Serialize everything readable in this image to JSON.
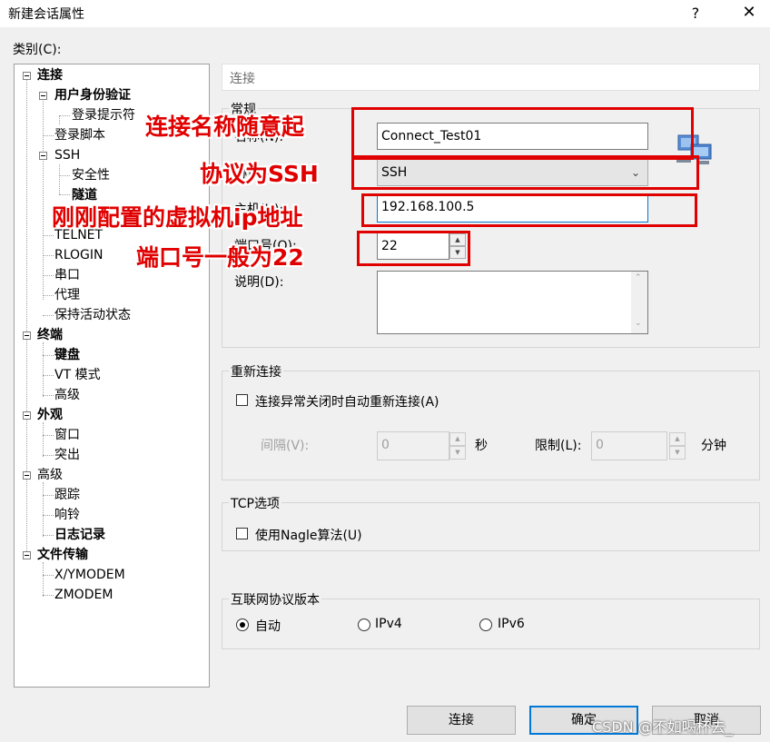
{
  "window": {
    "title": "新建会话属性",
    "help_label": "?",
    "close_label": "✕"
  },
  "category_label": "类别(C):",
  "tree": {
    "items": [
      {
        "label": "连接"
      },
      {
        "label": "用户身份验证"
      },
      {
        "label": "登录提示符"
      },
      {
        "label": "登录脚本"
      },
      {
        "label": "SSH"
      },
      {
        "label": "安全性"
      },
      {
        "label": "隧道"
      },
      {
        "label": "TELNET"
      },
      {
        "label": "RLOGIN"
      },
      {
        "label": "串口"
      },
      {
        "label": "代理"
      },
      {
        "label": "保持活动状态"
      },
      {
        "label": "终端"
      },
      {
        "label": "键盘"
      },
      {
        "label": "VT 模式"
      },
      {
        "label": "高级"
      },
      {
        "label": "外观"
      },
      {
        "label": "窗口"
      },
      {
        "label": "突出"
      },
      {
        "label": "高级"
      },
      {
        "label": "跟踪"
      },
      {
        "label": "响铃"
      },
      {
        "label": "日志记录"
      },
      {
        "label": "文件传输"
      },
      {
        "label": "X/YMODEM"
      },
      {
        "label": "ZMODEM"
      }
    ]
  },
  "section_header": "连接",
  "general": {
    "title": "常规",
    "name_label": "名称(N):",
    "name_value": "Connect_Test01",
    "protocol_label": "协议(P):",
    "protocol_value": "SSH",
    "host_label": "主机(H):",
    "host_value": "192.168.100.5",
    "port_label": "端口号(O):",
    "port_value": "22",
    "desc_label": "说明(D):",
    "desc_value": ""
  },
  "reconnect": {
    "title": "重新连接",
    "checkbox_label": "连接异常关闭时自动重新连接(A)",
    "interval_label": "间隔(V):",
    "interval_value": "0",
    "interval_unit": "秒",
    "limit_label": "限制(L):",
    "limit_value": "0",
    "limit_unit": "分钟"
  },
  "tcp": {
    "title": "TCP选项",
    "nagle_label": "使用Nagle算法(U)"
  },
  "ip_version": {
    "title": "互联网协议版本",
    "options": [
      {
        "label": "自动",
        "selected": true
      },
      {
        "label": "IPv4",
        "selected": false
      },
      {
        "label": "IPv6",
        "selected": false
      }
    ]
  },
  "buttons": {
    "connect": "连接",
    "ok": "确定",
    "cancel": "取消"
  },
  "annotations": {
    "name": "连接名称随意起",
    "protocol": "协议为SSH",
    "host": "刚刚配置的虚拟机ip地址",
    "port": "端口号一般为22"
  },
  "watermark": "CSDN @不如喝杯去_",
  "colors": {
    "annotation": "#e00000",
    "default_button_border": "#0078d7"
  }
}
